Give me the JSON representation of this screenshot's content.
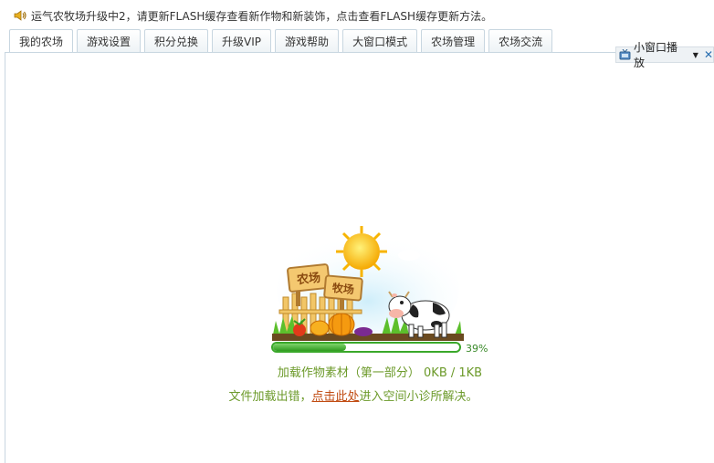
{
  "notice": {
    "text": "运气农牧场升级中2，请更新FLASH缓存查看新作物和新装饰，点击查看FLASH缓存更新方法。"
  },
  "tabs": [
    {
      "label": "我的农场"
    },
    {
      "label": "游戏设置"
    },
    {
      "label": "积分兑换"
    },
    {
      "label": "升级VIP"
    },
    {
      "label": "游戏帮助"
    },
    {
      "label": "大窗口模式"
    },
    {
      "label": "农场管理"
    },
    {
      "label": "农场交流"
    }
  ],
  "mini_player": {
    "label": "小窗口播放"
  },
  "illustration": {
    "sign_left": "农场",
    "sign_right": "牧场"
  },
  "loading": {
    "progress": 0.39,
    "percent_label": "39%",
    "status": "加载作物素材（第一部分） 0KB / 1KB",
    "error_prefix": "文件加载出错，",
    "error_link": "点击此处",
    "error_suffix": "进入空间小诊所解决。"
  },
  "colors": {
    "accent_green": "#3aa82a",
    "text_green": "#6c9a2a",
    "link": "#c04a10",
    "tab_border": "#c8d6e0"
  }
}
